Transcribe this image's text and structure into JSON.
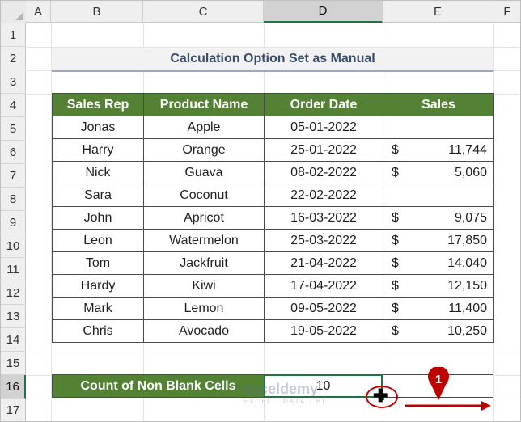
{
  "columns": [
    "A",
    "B",
    "C",
    "D",
    "E",
    "F"
  ],
  "rows": [
    "1",
    "2",
    "3",
    "4",
    "5",
    "6",
    "7",
    "8",
    "9",
    "10",
    "11",
    "12",
    "13",
    "14",
    "15",
    "16",
    "17"
  ],
  "title": "Calculation Option Set as Manual",
  "table": {
    "headers": [
      "Sales Rep",
      "Product Name",
      "Order Date",
      "Sales"
    ],
    "rows": [
      {
        "rep": "Jonas",
        "product": "Apple",
        "date": "05-01-2022",
        "currency": "",
        "amount": ""
      },
      {
        "rep": "Harry",
        "product": "Orange",
        "date": "25-01-2022",
        "currency": "$",
        "amount": "11,744"
      },
      {
        "rep": "Nick",
        "product": "Guava",
        "date": "08-02-2022",
        "currency": "$",
        "amount": "5,060"
      },
      {
        "rep": "Sara",
        "product": "Coconut",
        "date": "22-02-2022",
        "currency": "",
        "amount": ""
      },
      {
        "rep": "John",
        "product": "Apricot",
        "date": "16-03-2022",
        "currency": "$",
        "amount": "9,075"
      },
      {
        "rep": "Leon",
        "product": "Watermelon",
        "date": "25-03-2022",
        "currency": "$",
        "amount": "17,850"
      },
      {
        "rep": "Tom",
        "product": "Jackfruit",
        "date": "21-04-2022",
        "currency": "$",
        "amount": "14,040"
      },
      {
        "rep": "Hardy",
        "product": "Kiwi",
        "date": "17-04-2022",
        "currency": "$",
        "amount": "12,150"
      },
      {
        "rep": "Mark",
        "product": "Lemon",
        "date": "09-05-2022",
        "currency": "$",
        "amount": "11,400"
      },
      {
        "rep": "Chris",
        "product": "Avocado",
        "date": "19-05-2022",
        "currency": "$",
        "amount": "10,250"
      }
    ]
  },
  "count": {
    "label": "Count of Non Blank Cells",
    "value": "10"
  },
  "watermark": {
    "name": "exceldemy",
    "tagline": "EXCEL · DATA · BI"
  },
  "marker": {
    "number": "1"
  },
  "colors": {
    "header_green": "#548235",
    "selection_green": "#217346",
    "annotation_red": "#c00000"
  },
  "icons": [
    "fill-cursor-icon",
    "step-marker-icon",
    "drag-arrow-icon",
    "select-all-icon"
  ]
}
